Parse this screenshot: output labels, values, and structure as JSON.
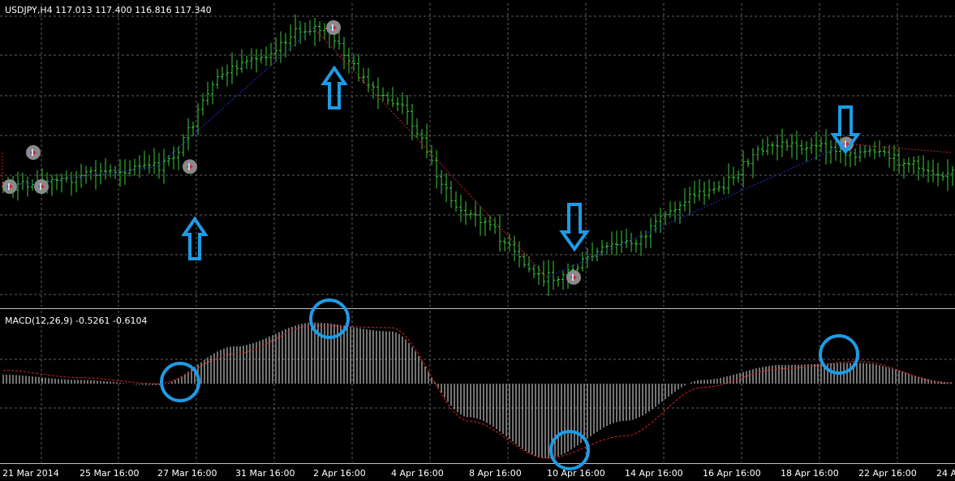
{
  "price_panel": {
    "header": "USDJPY,H4  117.013 117.400 116.816 117.340"
  },
  "macd_panel": {
    "header": "MACD(12,26,9) -0.5261 -0.6104"
  },
  "x_axis": {
    "labels": [
      "21 Mar 2014",
      "25 Mar 16:00",
      "27 Mar 16:00",
      "31 Mar 16:00",
      "2 Apr 16:00",
      "4 Apr 16:00",
      "8 Apr 16:00",
      "10 Apr 16:00",
      "14 Apr 16:00",
      "16 Apr 16:00",
      "18 Apr 16:00",
      "22 Apr 16:00",
      "24 A"
    ]
  },
  "colors": {
    "background": "#000000",
    "grid": "#5f5f5f",
    "border": "#c0c0c0",
    "candle": "#3ccc3c",
    "zigzag_up": "#2233cc",
    "zigzag_down": "#cc2222",
    "macd_hist": "#e8e8e8",
    "signal": "#e02020",
    "annotation": "#1e9be6",
    "text": "#ffffff"
  },
  "chart_data": [
    {
      "type": "line",
      "subtype": "ohlc-bars",
      "symbol": "USDJPY",
      "timeframe": "H4",
      "ohlc_last": {
        "open": 117.013,
        "high": 117.4,
        "low": 116.816,
        "close": 117.34
      },
      "anchors": [
        {
          "date": "21 Mar 2014",
          "price": 0.4
        },
        {
          "date": "21 Mar 2014",
          "price": 0.52
        },
        {
          "date": "21 Mar 2014",
          "price": 0.4
        },
        {
          "date": "27 Mar 16:00",
          "price": 0.47
        },
        {
          "date": "31 Mar 16:00",
          "price": 0.82
        },
        {
          "date": "2 Apr 16:00",
          "price": 0.96
        },
        {
          "date": "4 Apr 16:00",
          "price": 0.7
        },
        {
          "date": "8 Apr 16:00",
          "price": 0.3
        },
        {
          "date": "10 Apr 16:00",
          "price": 0.08
        },
        {
          "date": "14 Apr 16:00",
          "price": 0.2
        },
        {
          "date": "16 Apr 16:00",
          "price": 0.38
        },
        {
          "date": "18 Apr 16:00",
          "price": 0.55
        },
        {
          "date": "22 Apr 16:00",
          "price": 0.52
        },
        {
          "date": "24 Apr",
          "price": 0.45
        }
      ],
      "zigzag": [
        {
          "date": "21 Mar 2014",
          "price": 0.4
        },
        {
          "date": "21 Mar 2014",
          "price": 0.52
        },
        {
          "date": "21 Mar 2014",
          "price": 0.4
        },
        {
          "date": "27 Mar 16:00",
          "price": 0.47
        },
        {
          "date": "2 Apr 16:00",
          "price": 0.96
        },
        {
          "date": "10 Apr 16:00",
          "price": 0.08
        },
        {
          "date": "20 Apr",
          "price": 0.55
        },
        {
          "date": "24 Apr",
          "price": 0.52
        }
      ],
      "signals": [
        {
          "date": "27 Mar 16:00",
          "direction": "up"
        },
        {
          "date": "2 Apr 16:00",
          "direction": "up"
        },
        {
          "date": "10 Apr 16:00",
          "direction": "down"
        },
        {
          "date": "20 Apr",
          "direction": "down"
        }
      ]
    },
    {
      "type": "bar",
      "indicator": "MACD(12,26,9)",
      "values_last": {
        "macd": -0.5261,
        "signal": -0.6104
      },
      "histogram_anchors": [
        {
          "date": "21 Mar 2014",
          "value": 0.12
        },
        {
          "date": "25 Mar 16:00",
          "value": 0.05
        },
        {
          "date": "27 Mar 16:00",
          "value": -0.02
        },
        {
          "date": "31 Mar 16:00",
          "value": 0.5
        },
        {
          "date": "2 Apr 16:00",
          "value": 0.82
        },
        {
          "date": "4 Apr 16:00",
          "value": 0.7
        },
        {
          "date": "8 Apr 16:00",
          "value": -0.45
        },
        {
          "date": "10 Apr 16:00",
          "value": -1.0
        },
        {
          "date": "14 Apr 16:00",
          "value": -0.5
        },
        {
          "date": "16 Apr 16:00",
          "value": 0.05
        },
        {
          "date": "18 Apr 16:00",
          "value": 0.25
        },
        {
          "date": "22 Apr 16:00",
          "value": 0.28
        },
        {
          "date": "24 Apr",
          "value": 0.02
        }
      ],
      "signal_anchors": [
        {
          "date": "21 Mar 2014",
          "value": 0.18
        },
        {
          "date": "25 Mar 16:00",
          "value": 0.08
        },
        {
          "date": "27 Mar 16:00",
          "value": 0.0
        },
        {
          "date": "31 Mar 16:00",
          "value": 0.4
        },
        {
          "date": "2 Apr 16:00",
          "value": 0.78
        },
        {
          "date": "4 Apr 16:00",
          "value": 0.75
        },
        {
          "date": "8 Apr 16:00",
          "value": -0.5
        },
        {
          "date": "10 Apr 16:00",
          "value": -1.0
        },
        {
          "date": "14 Apr 16:00",
          "value": -0.7
        },
        {
          "date": "16 Apr 16:00",
          "value": -0.05
        },
        {
          "date": "18 Apr 16:00",
          "value": 0.2
        },
        {
          "date": "22 Apr 16:00",
          "value": 0.3
        },
        {
          "date": "24 Apr",
          "value": 0.0
        }
      ],
      "highlights": [
        "27 Mar 16:00",
        "2 Apr 16:00",
        "10 Apr 16:00",
        "20 Apr"
      ]
    }
  ]
}
